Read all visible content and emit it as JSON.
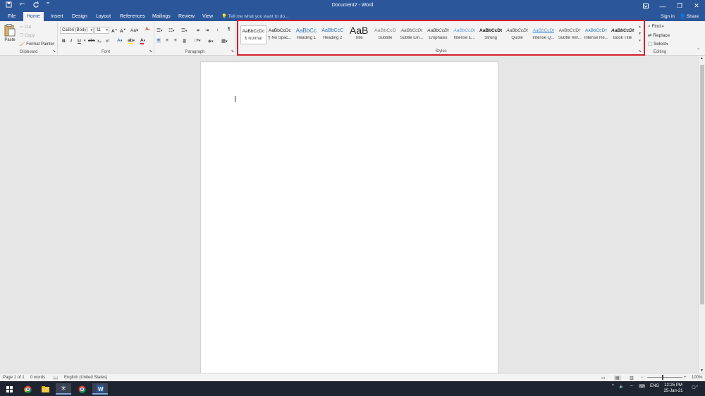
{
  "window": {
    "title": "Document2 - Word"
  },
  "qat": {
    "save": "save-icon",
    "undo": "undo-icon",
    "redo": "redo-icon",
    "customize": "customize-icon"
  },
  "tabs": [
    "File",
    "Home",
    "Insert",
    "Design",
    "Layout",
    "References",
    "Mailings",
    "Review",
    "View"
  ],
  "active_tab": "Home",
  "tell_me": {
    "placeholder": "Tell me what you want to do..."
  },
  "account": {
    "sign_in": "Sign in",
    "share": "Share"
  },
  "clipboard": {
    "paste": "Paste",
    "cut": "Cut",
    "copy": "Copy",
    "format_painter": "Format Painter",
    "label": "Clipboard"
  },
  "font": {
    "name": "Calibri (Body)",
    "size": "11",
    "change_case": "Aa",
    "bold": "B",
    "italic": "I",
    "underline": "U",
    "strike": "abc",
    "subscript": "x₂",
    "superscript": "x²",
    "label": "Font"
  },
  "paragraph": {
    "label": "Paragraph",
    "pilcrow": "¶"
  },
  "styles": {
    "label": "Styles",
    "items": [
      {
        "preview": "AaBbCcDc",
        "name": "¶ Normal",
        "color": "#222222",
        "style": "normal"
      },
      {
        "preview": "AaBbCcDc",
        "name": "¶ No Spac...",
        "color": "#222222",
        "style": "normal"
      },
      {
        "preview": "AaBbCc",
        "name": "Heading 1",
        "color": "#2e74b5",
        "style": "h1"
      },
      {
        "preview": "AaBbCcC",
        "name": "Heading 2",
        "color": "#2e74b5",
        "style": "h2"
      },
      {
        "preview": "AaB",
        "name": "Title",
        "color": "#222222",
        "style": "title"
      },
      {
        "preview": "AaBbCcD",
        "name": "Subtitle",
        "color": "#777777",
        "style": "subtitle"
      },
      {
        "preview": "AaBbCcDt",
        "name": "Subtle Em...",
        "color": "#555555",
        "style": "italic"
      },
      {
        "preview": "AaBbCcDt",
        "name": "Emphasis",
        "color": "#333333",
        "style": "italic"
      },
      {
        "preview": "AaBbCcDt",
        "name": "Intense E...",
        "color": "#5b9bd5",
        "style": "italic"
      },
      {
        "preview": "AaBbCcDt",
        "name": "Strong",
        "color": "#111111",
        "style": "bold"
      },
      {
        "preview": "AaBbCcDt",
        "name": "Quote",
        "color": "#444444",
        "style": "italic"
      },
      {
        "preview": "AaBbCcDt",
        "name": "Intense Q...",
        "color": "#5b9bd5",
        "style": "italic-underline"
      },
      {
        "preview": "AaBbCcDt",
        "name": "Subtle Ref...",
        "color": "#555555",
        "style": "smallcaps"
      },
      {
        "preview": "AaBbCcDt",
        "name": "Intense Re...",
        "color": "#2e74b5",
        "style": "smallcaps"
      },
      {
        "preview": "AaBbCcDt",
        "name": "Book Title",
        "color": "#222222",
        "style": "bold-italic"
      }
    ]
  },
  "editing": {
    "find": "Find",
    "replace": "Replace",
    "select": "Select",
    "label": "Editing"
  },
  "status": {
    "page": "Page 1 of 1",
    "words": "0 words",
    "language": "English (United States)",
    "zoom": "100%"
  },
  "taskbar": {
    "lang": "ENG",
    "time": "12:25 PM",
    "date": "25-Jan-21",
    "notifications": "2"
  },
  "colors": {
    "accent": "#2b579a",
    "highlight_border": "#d0202e"
  }
}
